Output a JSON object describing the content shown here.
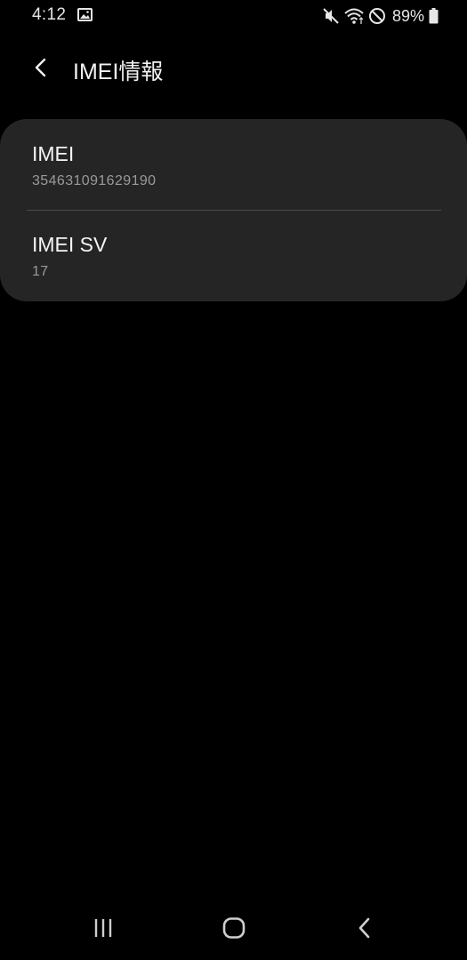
{
  "status_bar": {
    "time": "4:12",
    "battery": "89%",
    "icons": [
      "image-icon",
      "mute-icon",
      "wifi-icon",
      "do-not-disturb-icon",
      "battery-icon"
    ]
  },
  "header": {
    "title": "IMEI情報",
    "back_icon": "chevron-left-icon"
  },
  "items": [
    {
      "title": "IMEI",
      "value": "354631091629190"
    },
    {
      "title": "IMEI SV",
      "value": "17"
    }
  ],
  "nav_bar": {
    "icons": [
      "recents-icon",
      "home-icon",
      "back-icon"
    ]
  },
  "colors": {
    "background": "#000000",
    "card": "#252525",
    "primary_text": "#f4f4f4",
    "secondary_text": "#9a9a9a",
    "divider": "#4a4a4a"
  }
}
